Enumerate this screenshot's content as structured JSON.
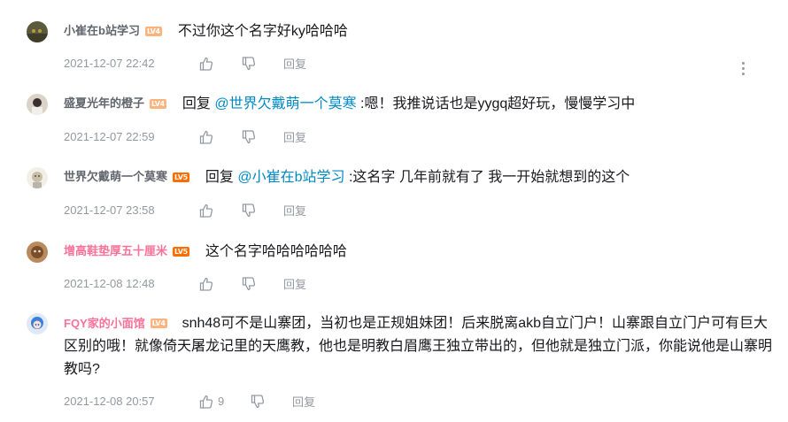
{
  "colors": {
    "text": "#18191c",
    "muted": "#9499a0",
    "link": "#008ac5",
    "vip_name": "#fb7299",
    "lv4": "#ffb37c",
    "lv5": "#ff6c00"
  },
  "icons": {
    "like": "thumbs-up-icon",
    "dislike": "thumbs-down-icon",
    "more": "more-vertical-icon"
  },
  "replies": [
    {
      "username": "小崔在b站学习",
      "level": "LV4",
      "prefix": "",
      "mention": "",
      "text": "不过你这个名字好ky哈哈哈",
      "time": "2021-12-07 22:42",
      "likes": "",
      "reply_label": "回复"
    },
    {
      "username": "盛夏光年的橙子",
      "level": "LV4",
      "prefix": "回复",
      "mention": "@世界欠戴萌一个莫寒",
      "text": ":嗯！我推说话也是yygq超好玩，慢慢学习中",
      "time": "2021-12-07 22:59",
      "likes": "",
      "reply_label": "回复"
    },
    {
      "username": "世界欠戴萌一个莫寒",
      "level": "LV5",
      "prefix": "回复",
      "mention": "@小崔在b站学习",
      "text": ":这名字 几年前就有了 我一开始就想到的这个",
      "time": "2021-12-07 23:58",
      "likes": "",
      "reply_label": "回复"
    },
    {
      "username": "增高鞋垫厚五十厘米",
      "level": "LV5",
      "prefix": "",
      "mention": "",
      "text": "这个名字哈哈哈哈哈哈",
      "time": "2021-12-08 12:48",
      "likes": "",
      "reply_label": "回复"
    },
    {
      "username": "FQY家的小面馆",
      "level": "LV4",
      "prefix": "",
      "mention": "",
      "text": "snh48可不是山寨团，当初也是正规姐妹团！后来脱离akb自立门户！山寨跟自立门户可有巨大区别的哦！就像倚天屠龙记里的天鹰教，他也是明教白眉鹰王独立带出的，但他就是独立门派，你能说他是山寨明教吗?",
      "time": "2021-12-08 20:57",
      "likes": "9",
      "reply_label": "回复"
    }
  ]
}
